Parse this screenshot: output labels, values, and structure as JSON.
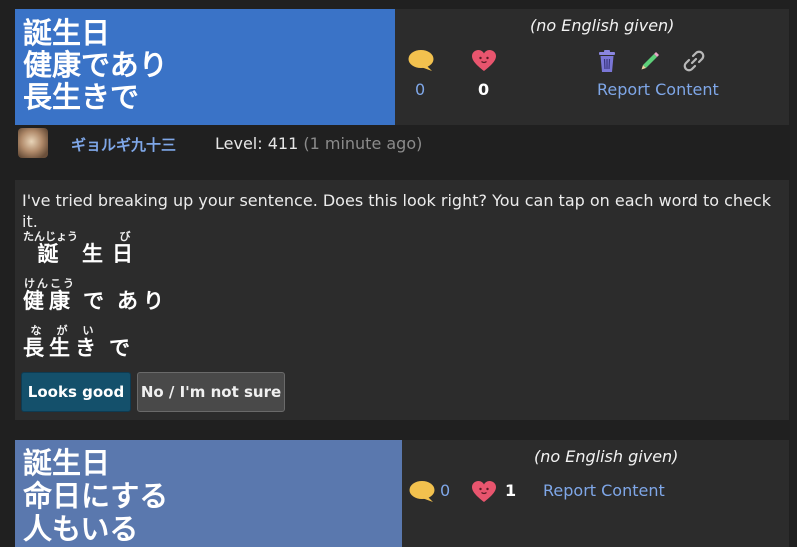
{
  "post1": {
    "japanese_lines": [
      "誕生日",
      "健康であり",
      "長生きで"
    ],
    "no_english": "(no English given)",
    "comment_count": "0",
    "like_count": "0",
    "report_label": "Report Content"
  },
  "user": {
    "name": "ギョルギ九十三",
    "level": "Level: 411",
    "time": "(1 minute ago)"
  },
  "check": {
    "message": "I've tried breaking up your sentence. Does this look right? You can tap on each word to check it.",
    "lines": [
      {
        "words": [
          {
            "text": "誕",
            "reading": "たんじょう"
          },
          {
            "text": "生",
            "reading": ""
          },
          {
            "text": "日",
            "reading": "び"
          }
        ]
      },
      {
        "words": [
          {
            "text": "健康",
            "reading": "けんこう"
          },
          {
            "text": "で",
            "reading": ""
          },
          {
            "text": "あり",
            "reading": ""
          }
        ]
      },
      {
        "words": [
          {
            "text": "長生き",
            "reading": "ながい"
          },
          {
            "text": "で",
            "reading": ""
          }
        ]
      }
    ],
    "looks_good_label": "Looks good",
    "not_sure_label": "No / I'm not sure"
  },
  "post2": {
    "japanese_lines": [
      "誕生日",
      "命日にする",
      "人もいる"
    ],
    "no_english": "(no English given)",
    "comment_count": "0",
    "like_count": "1",
    "report_label": "Report Content"
  },
  "colors": {
    "post1_bg": "#3a73c7",
    "post2_bg": "#5a78ae",
    "link": "#7fa7e8",
    "looks_good_bg": "#14506b"
  },
  "icons": [
    "speech-bubble-icon",
    "heart-icon",
    "trash-icon",
    "pencil-icon",
    "link-icon"
  ]
}
